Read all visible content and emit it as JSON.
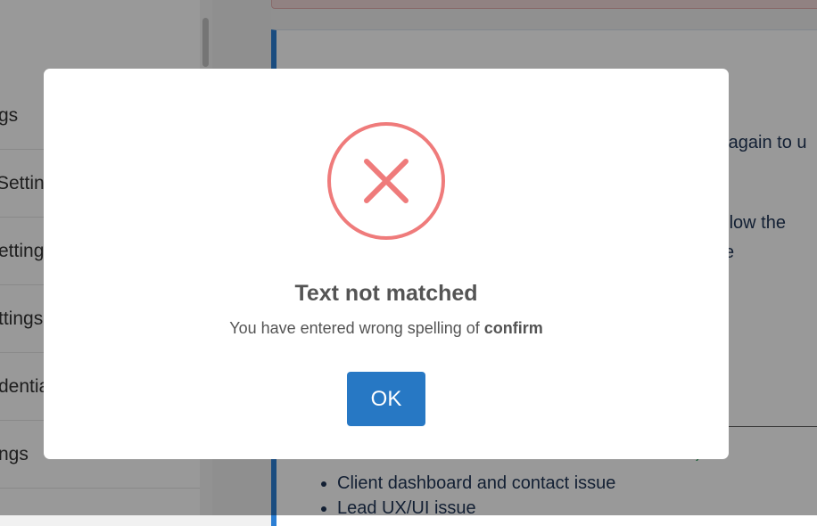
{
  "sidebar": {
    "items": [
      {
        "label": "gs"
      },
      {
        "label": "Settin"
      },
      {
        "label": "ettings"
      },
      {
        "label": "ttings"
      },
      {
        "label": "dentia"
      },
      {
        "label": "ngs"
      }
    ]
  },
  "info_panel": {
    "line1": "n again to u",
    "line2": "ollow the",
    "line3": "e"
  },
  "issues": {
    "partial_heading": ")",
    "items": [
      {
        "label": "Client dashboard and contact issue"
      },
      {
        "label": "Lead UX/UI issue"
      }
    ]
  },
  "modal": {
    "icon": "error-x-icon",
    "title": "Text not matched",
    "message_prefix": "You have entered wrong spelling of ",
    "message_keyword": "confirm",
    "ok_label": "OK"
  },
  "colors": {
    "error": "#ef7b7b",
    "primary_button": "#2778c4",
    "panel_accent": "#2c7fd4"
  }
}
